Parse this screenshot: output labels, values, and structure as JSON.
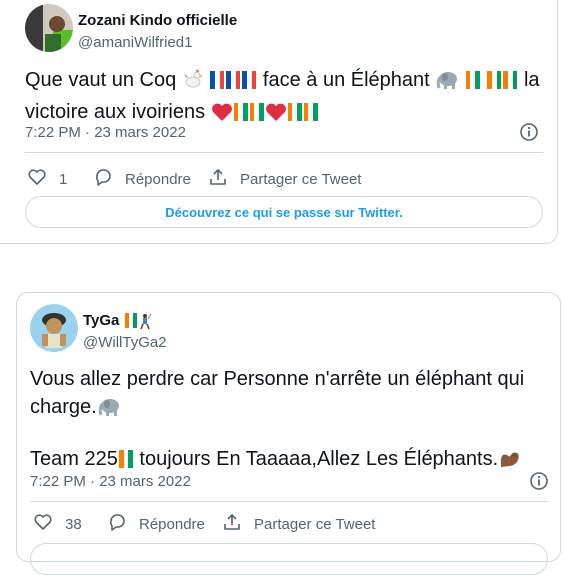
{
  "tweet1": {
    "name": "Zozani Kindo officielle",
    "handle": "@amaniWilfried1",
    "text_part1": "Que vaut un Coq",
    "text_part2": "face à un Éléphant",
    "text_part3": "la victoire aux ivoiriens",
    "timestamp": "7:22 PM · 23 mars 2022",
    "likes": "1",
    "reply_label": "Répondre",
    "share_label": "Partager ce Tweet",
    "cta_label": "Découvrez ce qui se passe sur Twitter."
  },
  "tweet2": {
    "name": "TyGa",
    "handle": "@WillTyGa2",
    "text_line1": "Vous allez perdre car Personne n'arrête un éléphant qui",
    "text_line2": "charge.",
    "text_line3a": "Team 225",
    "text_line3b": "toujours En Taaaaa,Allez Les Éléphants.",
    "timestamp": "7:22 PM · 23 mars 2022",
    "likes": "38",
    "reply_label": "Répondre",
    "share_label": "Partager ce Tweet"
  },
  "icons": [
    "rooster-emoji",
    "france-flag",
    "elephant-emoji",
    "ivory-coast-flag",
    "heart-emoji",
    "flexed-biceps-emoji",
    "golfer-emoji",
    "heart-icon",
    "reply-icon",
    "share-icon",
    "info-icon"
  ],
  "colors": {
    "accent": "#1d9bf0",
    "text": "#0f1419",
    "muted": "#536471",
    "border": "#cfd9de",
    "heart": "#e0245e"
  }
}
